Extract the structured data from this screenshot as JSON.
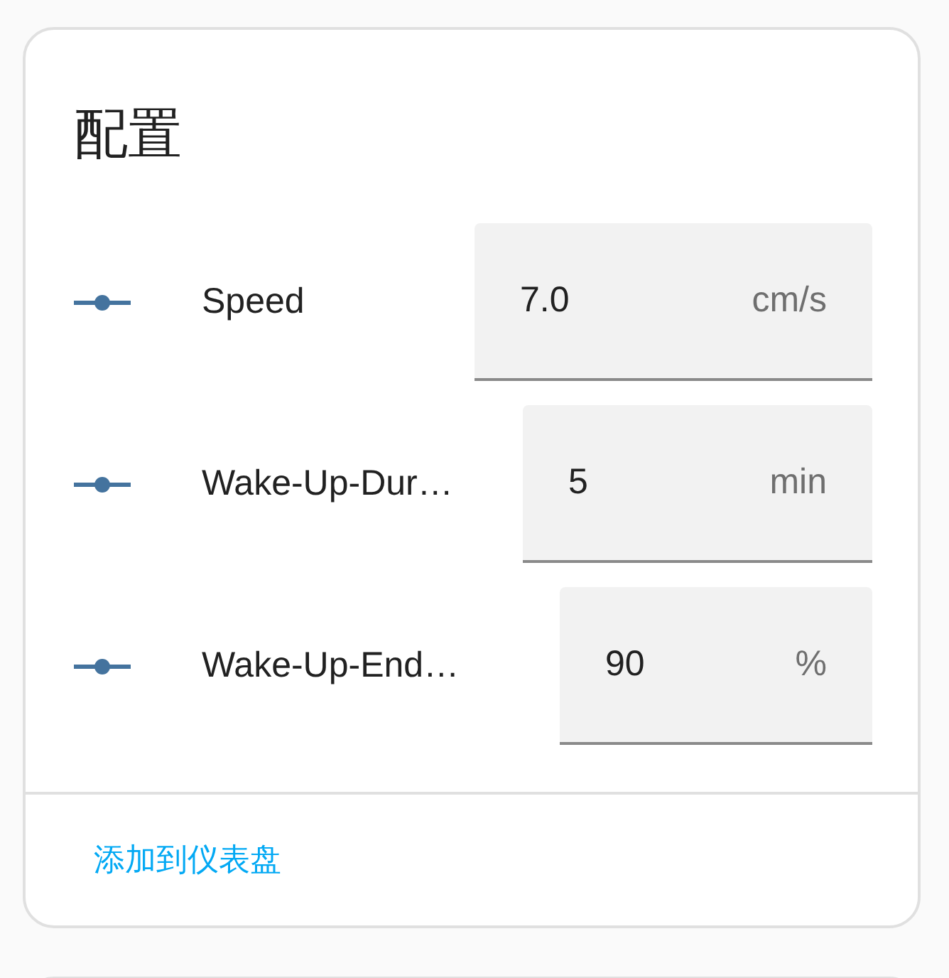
{
  "card": {
    "title": "配置",
    "rows": [
      {
        "label": "Speed",
        "value": "7.0",
        "unit": "cm/s"
      },
      {
        "label": "Wake-Up-Dur…",
        "value": "5",
        "unit": "min"
      },
      {
        "label": "Wake-Up-End…",
        "value": "90",
        "unit": "%"
      }
    ],
    "footer_link": "添加到仪表盘"
  }
}
